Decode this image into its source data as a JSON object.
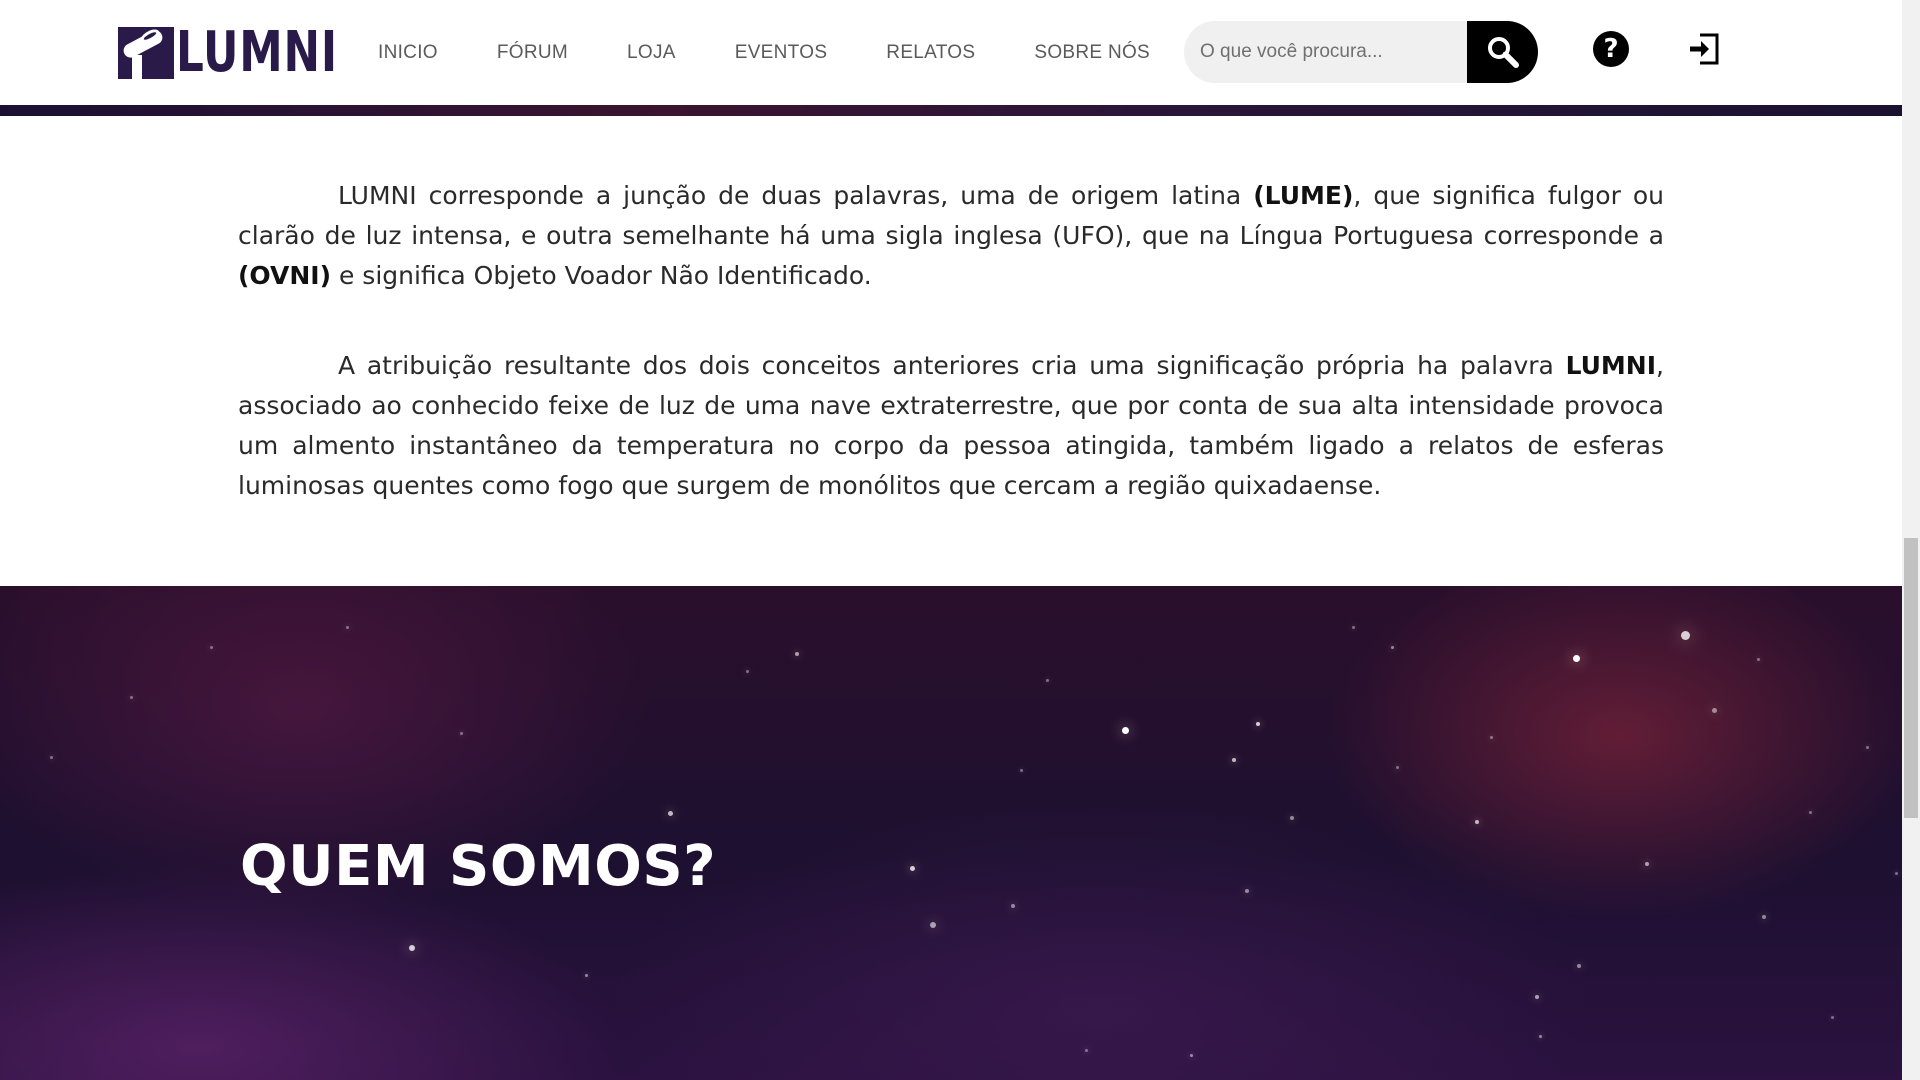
{
  "header": {
    "logo_text": "LUMNI",
    "nav": [
      {
        "label": "INICIO"
      },
      {
        "label": "FÓRUM"
      },
      {
        "label": "LOJA"
      },
      {
        "label": "EVENTOS"
      },
      {
        "label": "RELATOS"
      },
      {
        "label": "SOBRE NÓS"
      }
    ],
    "search": {
      "placeholder": "O que você procura..."
    },
    "icons": {
      "search": "search-icon",
      "help": "help-icon",
      "login": "login-icon"
    }
  },
  "content": {
    "p1": {
      "t1": "LUMNI corresponde a junção de duas palavras, uma de origem latina ",
      "b1": "(LUME)",
      "t2": ", que significa fulgor ou clarão de luz intensa, e outra semelhante há uma sigla inglesa (UFO), que na Língua Portuguesa corresponde a ",
      "b2": "(OVNI)",
      "t3": " e significa Objeto Voador Não Identificado."
    },
    "p2": {
      "t1": "A atribuição resultante dos dois conceitos anteriores cria uma significação própria ha palavra ",
      "b1": "LUMNI",
      "t2": ", associado ao conhecido feixe de luz de uma nave extraterrestre, que por conta de sua alta intensidade provoca um almento instantâneo da temperatura no corpo da pessoa atingida, também ligado a relatos de esferas luminosas quentes como fogo que surgem de monólitos que cercam a região quixadaense."
    }
  },
  "about": {
    "title": "QUEM SOMOS?"
  },
  "colors": {
    "brand": "#2a1a4a",
    "nav_text": "#5a5a5a",
    "space_bg": "#1d1030"
  }
}
